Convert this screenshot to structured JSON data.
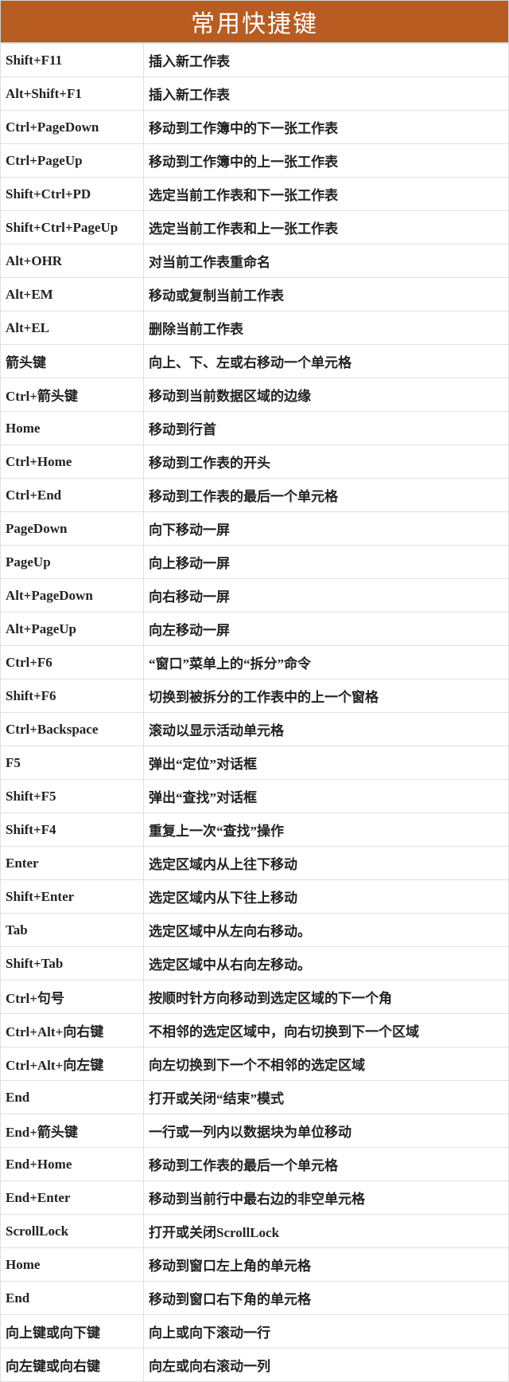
{
  "title": "常用快捷键",
  "rows": [
    {
      "key": "Shift+F11",
      "desc": "插入新工作表"
    },
    {
      "key": "Alt+Shift+F1",
      "desc": "插入新工作表"
    },
    {
      "key": "Ctrl+PageDown",
      "desc": "移动到工作簿中的下一张工作表"
    },
    {
      "key": "Ctrl+PageUp",
      "desc": "移动到工作簿中的上一张工作表"
    },
    {
      "key": "Shift+Ctrl+PD",
      "desc": "选定当前工作表和下一张工作表"
    },
    {
      "key": "Shift+Ctrl+PageUp",
      "desc": "选定当前工作表和上一张工作表"
    },
    {
      "key": "Alt+OHR",
      "desc": "对当前工作表重命名"
    },
    {
      "key": "Alt+EM",
      "desc": "移动或复制当前工作表"
    },
    {
      "key": "Alt+EL",
      "desc": "删除当前工作表"
    },
    {
      "key": "箭头键",
      "desc": "向上、下、左或右移动一个单元格"
    },
    {
      "key": "Ctrl+箭头键",
      "desc": "移动到当前数据区域的边缘"
    },
    {
      "key": "Home",
      "desc": "移动到行首"
    },
    {
      "key": "Ctrl+Home",
      "desc": "移动到工作表的开头"
    },
    {
      "key": "Ctrl+End",
      "desc": "移动到工作表的最后一个单元格"
    },
    {
      "key": "PageDown",
      "desc": "向下移动一屏"
    },
    {
      "key": "PageUp",
      "desc": "向上移动一屏"
    },
    {
      "key": "Alt+PageDown",
      "desc": "向右移动一屏"
    },
    {
      "key": "Alt+PageUp",
      "desc": "向左移动一屏"
    },
    {
      "key": "Ctrl+F6",
      "desc": "“窗口”菜单上的“拆分”命令"
    },
    {
      "key": "Shift+F6",
      "desc": "切换到被拆分的工作表中的上一个窗格"
    },
    {
      "key": "Ctrl+Backspace",
      "desc": "滚动以显示活动单元格"
    },
    {
      "key": "F5",
      "desc": "弹出“定位”对话框"
    },
    {
      "key": "Shift+F5",
      "desc": "弹出“查找”对话框"
    },
    {
      "key": "Shift+F4",
      "desc": "重复上一次“查找”操作"
    },
    {
      "key": "Enter",
      "desc": "选定区域内从上往下移动"
    },
    {
      "key": "Shift+Enter",
      "desc": "选定区域内从下往上移动"
    },
    {
      "key": "Tab",
      "desc": "选定区域中从左向右移动。"
    },
    {
      "key": "Shift+Tab",
      "desc": "选定区域中从右向左移动。"
    },
    {
      "key": "Ctrl+句号",
      "desc": "按顺时针方向移动到选定区域的下一个角"
    },
    {
      "key": "Ctrl+Alt+向右键",
      "desc": "不相邻的选定区域中，向右切换到下一个区域"
    },
    {
      "key": "Ctrl+Alt+向左键",
      "desc": "向左切换到下一个不相邻的选定区域"
    },
    {
      "key": "End",
      "desc": "打开或关闭“结束”模式"
    },
    {
      "key": "End+箭头键",
      "desc": "一行或一列内以数据块为单位移动"
    },
    {
      "key": "End+Home",
      "desc": "移动到工作表的最后一个单元格"
    },
    {
      "key": "End+Enter",
      "desc": "移动到当前行中最右边的非空单元格"
    },
    {
      "key": "ScrollLock",
      "desc": "打开或关闭ScrollLock"
    },
    {
      "key": "Home",
      "desc": "移动到窗口左上角的单元格"
    },
    {
      "key": "End",
      "desc": "移动到窗口右下角的单元格"
    },
    {
      "key": "向上键或向下键",
      "desc": "向上或向下滚动一行"
    },
    {
      "key": "向左键或向右键",
      "desc": "向左或向右滚动一列"
    }
  ]
}
